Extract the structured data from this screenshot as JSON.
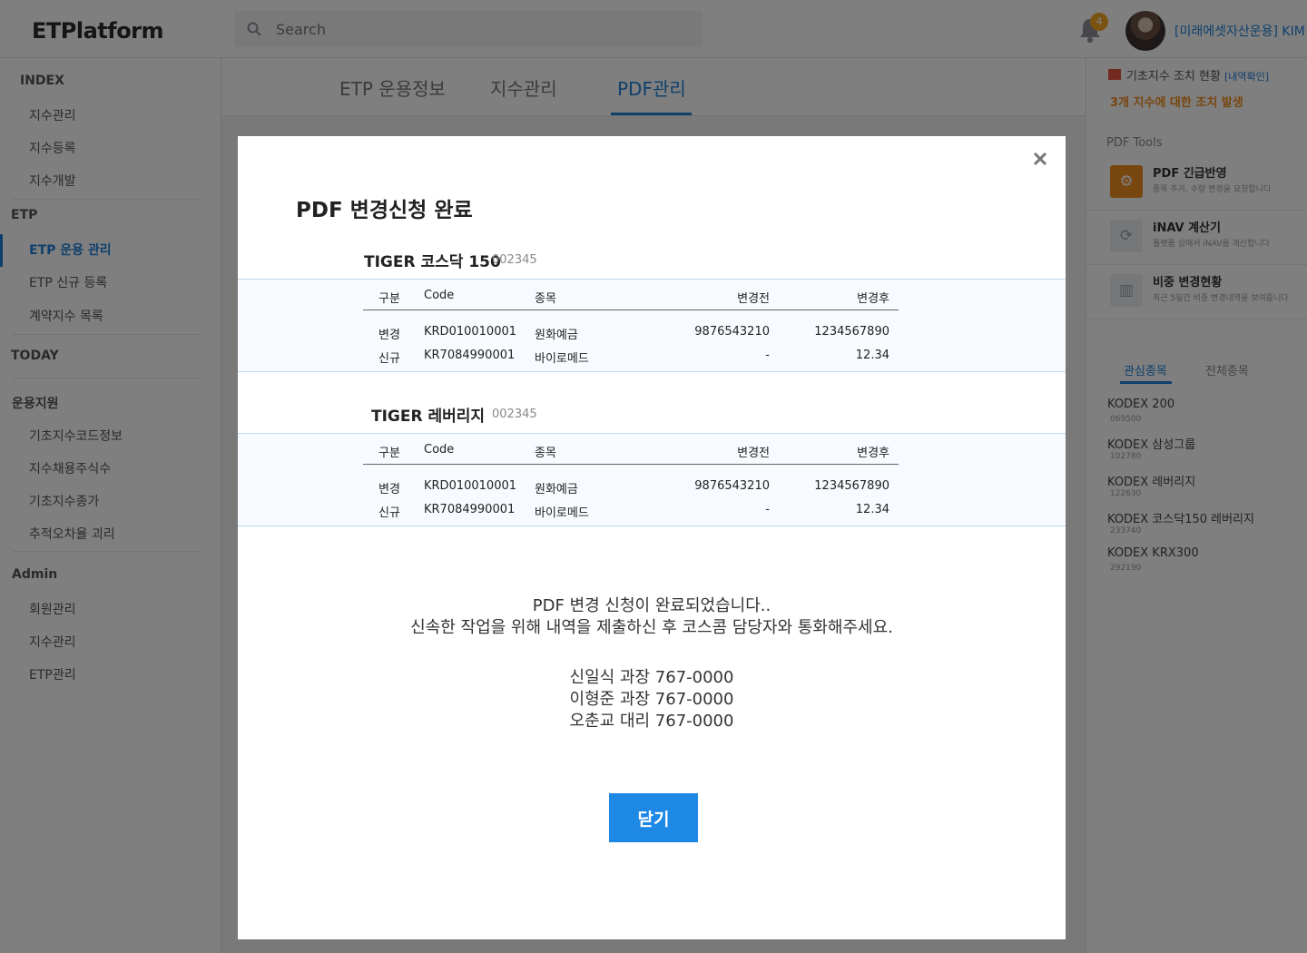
{
  "app": {
    "logo": "ETPlatform"
  },
  "header": {
    "search_placeholder": "Search",
    "notification_count": "4",
    "user_name": "[미래에셋자산운용] KIM"
  },
  "sidebar": {
    "sections": [
      {
        "title": "INDEX",
        "items": [
          "지수관리",
          "지수등록",
          "지수개발"
        ]
      },
      {
        "title": "ETP",
        "items": [
          "ETP 운용 관리",
          "ETP 신규 등록",
          "계약지수 목록"
        ]
      },
      {
        "title": "TODAY",
        "items": []
      },
      {
        "title": "운용지원",
        "items": [
          "기초지수코드정보",
          "지수채용주식수",
          "기초지수종가",
          "추적오차율 괴리"
        ]
      },
      {
        "title": "Admin",
        "items": [
          "회원관리",
          "지수관리",
          "ETP관리"
        ]
      }
    ],
    "active_item": "ETP 운용 관리"
  },
  "tabs": [
    "ETP 운용정보",
    "지수관리",
    "PDF관리"
  ],
  "active_tab": "PDF관리",
  "right_panel": {
    "notice_title": "기초지수 조치 현황",
    "notice_link": "[내역확인]",
    "notice_alert": "3개 지수에 대한 조치 발생",
    "tools_title": "PDF Tools",
    "tools": [
      {
        "title": "PDF 긴급반영",
        "desc": "종목 추가, 수량 변경을 요청합니다",
        "icon": "gear-icon"
      },
      {
        "title": "iNAV 계산기",
        "desc": "플랫폼 상에서 iNAV를 계산합니다",
        "icon": "refresh-icon"
      },
      {
        "title": "비중 변경현황",
        "desc": "최근 5일간 비중 변경내역을 보여줍니다",
        "icon": "bar-chart-icon"
      }
    ],
    "list_tabs": [
      "관심종목",
      "전체종목"
    ],
    "watchlist": [
      {
        "name": "KODEX 200",
        "code": "069500"
      },
      {
        "name": "KODEX 삼성그룹",
        "code": "102780"
      },
      {
        "name": "KODEX 레버리지",
        "code": "122630"
      },
      {
        "name": "KODEX 코스닥150 레버리지",
        "code": "233740"
      },
      {
        "name": "KODEX KRX300",
        "code": "292190"
      }
    ]
  },
  "modal": {
    "title": "PDF 변경신청 완료",
    "columns": [
      "구분",
      "Code",
      "종목",
      "변경전",
      "변경후"
    ],
    "products": [
      {
        "name": "TIGER 코스닥 150",
        "code": "002345",
        "rows": [
          [
            "변경",
            "KRD010010001",
            "원화예금",
            "9876543210",
            "1234567890"
          ],
          [
            "신규",
            "KR7084990001",
            "바이로메드",
            "-",
            "12.34"
          ]
        ]
      },
      {
        "name": "TIGER 레버리지",
        "code": "002345",
        "rows": [
          [
            "변경",
            "KRD010010001",
            "원화예금",
            "9876543210",
            "1234567890"
          ],
          [
            "신규",
            "KR7084990001",
            "바이로메드",
            "-",
            "12.34"
          ]
        ]
      }
    ],
    "message_line1": "PDF 변경 신청이 완료되었습니다..",
    "message_line2": "신속한 작업을 위해 내역을 제출하신 후 코스콤 담당자와 통화해주세요.",
    "contacts": [
      "신일식 과장 767-0000",
      "이형준 과장 767-0000",
      "오춘교 대리 767-0000"
    ],
    "close_label": "닫기"
  }
}
